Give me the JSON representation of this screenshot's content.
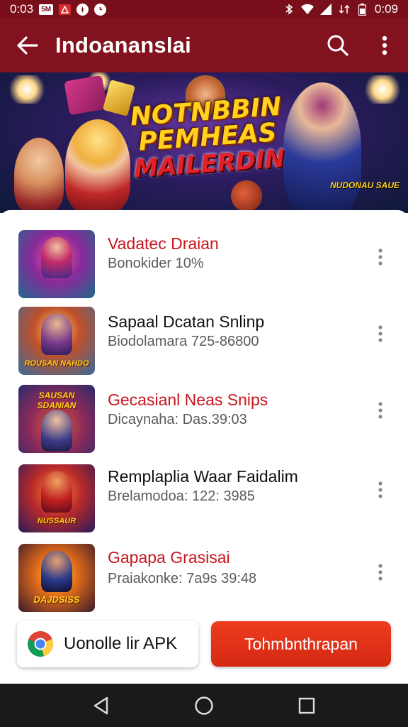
{
  "status_bar": {
    "time_left": "0:03",
    "notif_box": "5M",
    "time_right": "0:09"
  },
  "app_bar": {
    "title": "Indoananslai"
  },
  "hero": {
    "line1": "NOTNBBIN",
    "line2": "PEMHEAS",
    "line3": "MAILERDIN",
    "badge": "NUDONAU SAUE"
  },
  "games": [
    {
      "title": "Vadatec Draian",
      "subtitle": "Bonokider 10%",
      "title_color": "red",
      "thumb_label": ""
    },
    {
      "title": "Sapaal Dcatan Snlinp",
      "subtitle": "Biodolamara 725-86800",
      "title_color": "dark",
      "thumb_label": "ROUSAN NAHDO"
    },
    {
      "title": "Gecasianl Neas Snips",
      "subtitle": "Dicaynaha: Das.39:03",
      "title_color": "red",
      "thumb_label": "SAUSAN SDANIAN"
    },
    {
      "title": "Remplaplia Waar Faidalim",
      "subtitle": "Brelamodoa: 122: 3985",
      "title_color": "dark",
      "thumb_label": "NUSSAUR"
    },
    {
      "title": "Gapapa Grasisai",
      "subtitle": "Praiakonke: 7a9s 39:48",
      "title_color": "red",
      "thumb_label": "DAJDSISS"
    }
  ],
  "actions": {
    "apk_label": "Uonolle lir APK",
    "cta_label": "Tohmbnthrapan"
  },
  "colors": {
    "app_bar": "#83121f",
    "status_bar": "#7a0f1c",
    "accent_red": "#c8161e",
    "cta": "#e23519",
    "nav_bar": "#1a1a1a"
  },
  "icons": [
    "arrow-left-icon",
    "search-icon",
    "more-vert-icon",
    "chrome-icon",
    "nav-back-icon",
    "nav-home-icon",
    "nav-recents-icon"
  ]
}
